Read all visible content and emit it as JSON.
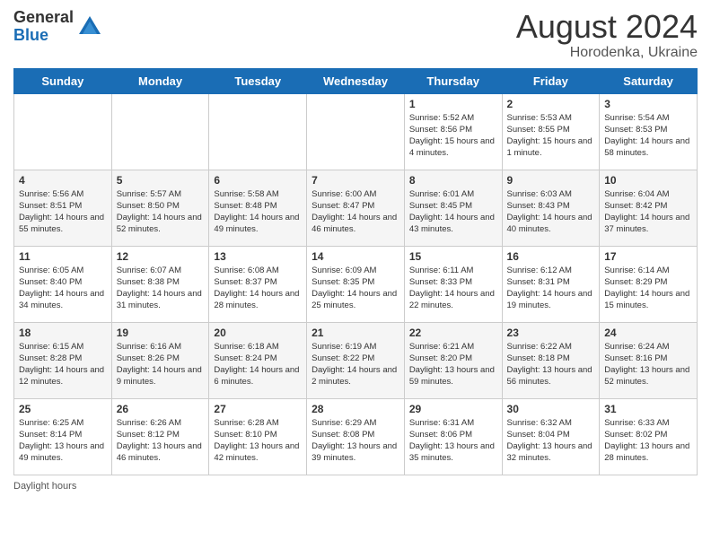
{
  "header": {
    "logo_general": "General",
    "logo_blue": "Blue",
    "month_year": "August 2024",
    "location": "Horodenka, Ukraine"
  },
  "footer": {
    "daylight_label": "Daylight hours"
  },
  "calendar": {
    "days_of_week": [
      "Sunday",
      "Monday",
      "Tuesday",
      "Wednesday",
      "Thursday",
      "Friday",
      "Saturday"
    ],
    "weeks": [
      [
        {
          "day": "",
          "info": ""
        },
        {
          "day": "",
          "info": ""
        },
        {
          "day": "",
          "info": ""
        },
        {
          "day": "",
          "info": ""
        },
        {
          "day": "1",
          "info": "Sunrise: 5:52 AM\nSunset: 8:56 PM\nDaylight: 15 hours\nand 4 minutes."
        },
        {
          "day": "2",
          "info": "Sunrise: 5:53 AM\nSunset: 8:55 PM\nDaylight: 15 hours\nand 1 minute."
        },
        {
          "day": "3",
          "info": "Sunrise: 5:54 AM\nSunset: 8:53 PM\nDaylight: 14 hours\nand 58 minutes."
        }
      ],
      [
        {
          "day": "4",
          "info": "Sunrise: 5:56 AM\nSunset: 8:51 PM\nDaylight: 14 hours\nand 55 minutes."
        },
        {
          "day": "5",
          "info": "Sunrise: 5:57 AM\nSunset: 8:50 PM\nDaylight: 14 hours\nand 52 minutes."
        },
        {
          "day": "6",
          "info": "Sunrise: 5:58 AM\nSunset: 8:48 PM\nDaylight: 14 hours\nand 49 minutes."
        },
        {
          "day": "7",
          "info": "Sunrise: 6:00 AM\nSunset: 8:47 PM\nDaylight: 14 hours\nand 46 minutes."
        },
        {
          "day": "8",
          "info": "Sunrise: 6:01 AM\nSunset: 8:45 PM\nDaylight: 14 hours\nand 43 minutes."
        },
        {
          "day": "9",
          "info": "Sunrise: 6:03 AM\nSunset: 8:43 PM\nDaylight: 14 hours\nand 40 minutes."
        },
        {
          "day": "10",
          "info": "Sunrise: 6:04 AM\nSunset: 8:42 PM\nDaylight: 14 hours\nand 37 minutes."
        }
      ],
      [
        {
          "day": "11",
          "info": "Sunrise: 6:05 AM\nSunset: 8:40 PM\nDaylight: 14 hours\nand 34 minutes."
        },
        {
          "day": "12",
          "info": "Sunrise: 6:07 AM\nSunset: 8:38 PM\nDaylight: 14 hours\nand 31 minutes."
        },
        {
          "day": "13",
          "info": "Sunrise: 6:08 AM\nSunset: 8:37 PM\nDaylight: 14 hours\nand 28 minutes."
        },
        {
          "day": "14",
          "info": "Sunrise: 6:09 AM\nSunset: 8:35 PM\nDaylight: 14 hours\nand 25 minutes."
        },
        {
          "day": "15",
          "info": "Sunrise: 6:11 AM\nSunset: 8:33 PM\nDaylight: 14 hours\nand 22 minutes."
        },
        {
          "day": "16",
          "info": "Sunrise: 6:12 AM\nSunset: 8:31 PM\nDaylight: 14 hours\nand 19 minutes."
        },
        {
          "day": "17",
          "info": "Sunrise: 6:14 AM\nSunset: 8:29 PM\nDaylight: 14 hours\nand 15 minutes."
        }
      ],
      [
        {
          "day": "18",
          "info": "Sunrise: 6:15 AM\nSunset: 8:28 PM\nDaylight: 14 hours\nand 12 minutes."
        },
        {
          "day": "19",
          "info": "Sunrise: 6:16 AM\nSunset: 8:26 PM\nDaylight: 14 hours\nand 9 minutes."
        },
        {
          "day": "20",
          "info": "Sunrise: 6:18 AM\nSunset: 8:24 PM\nDaylight: 14 hours\nand 6 minutes."
        },
        {
          "day": "21",
          "info": "Sunrise: 6:19 AM\nSunset: 8:22 PM\nDaylight: 14 hours\nand 2 minutes."
        },
        {
          "day": "22",
          "info": "Sunrise: 6:21 AM\nSunset: 8:20 PM\nDaylight: 13 hours\nand 59 minutes."
        },
        {
          "day": "23",
          "info": "Sunrise: 6:22 AM\nSunset: 8:18 PM\nDaylight: 13 hours\nand 56 minutes."
        },
        {
          "day": "24",
          "info": "Sunrise: 6:24 AM\nSunset: 8:16 PM\nDaylight: 13 hours\nand 52 minutes."
        }
      ],
      [
        {
          "day": "25",
          "info": "Sunrise: 6:25 AM\nSunset: 8:14 PM\nDaylight: 13 hours\nand 49 minutes."
        },
        {
          "day": "26",
          "info": "Sunrise: 6:26 AM\nSunset: 8:12 PM\nDaylight: 13 hours\nand 46 minutes."
        },
        {
          "day": "27",
          "info": "Sunrise: 6:28 AM\nSunset: 8:10 PM\nDaylight: 13 hours\nand 42 minutes."
        },
        {
          "day": "28",
          "info": "Sunrise: 6:29 AM\nSunset: 8:08 PM\nDaylight: 13 hours\nand 39 minutes."
        },
        {
          "day": "29",
          "info": "Sunrise: 6:31 AM\nSunset: 8:06 PM\nDaylight: 13 hours\nand 35 minutes."
        },
        {
          "day": "30",
          "info": "Sunrise: 6:32 AM\nSunset: 8:04 PM\nDaylight: 13 hours\nand 32 minutes."
        },
        {
          "day": "31",
          "info": "Sunrise: 6:33 AM\nSunset: 8:02 PM\nDaylight: 13 hours\nand 28 minutes."
        }
      ]
    ]
  }
}
